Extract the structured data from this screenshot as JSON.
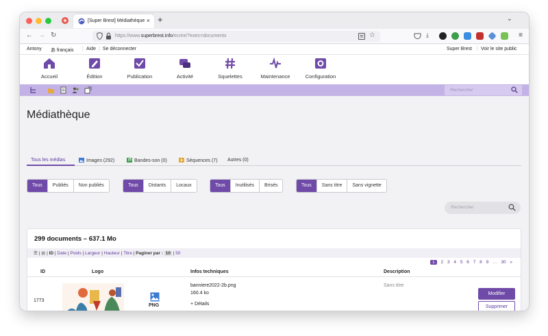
{
  "browser": {
    "tab_title": "[Super Brest] Médiathèque",
    "new_tab_symbol": "+",
    "close_symbol": "×",
    "url_prefix": "https://www.",
    "url_domain": "superbrest.info",
    "url_path": "/ecrire/?exec=documents"
  },
  "topbar": {
    "user": "Antony",
    "language": "français",
    "help": "Aide",
    "logout": "Se déconnecter",
    "site_name": "Super Brest",
    "view_site": "Voir le site public"
  },
  "main_menu": [
    {
      "label": "Accueil",
      "icon": "home-icon"
    },
    {
      "label": "Édition",
      "icon": "edit-pencil-icon"
    },
    {
      "label": "Publication",
      "icon": "checkbox-icon"
    },
    {
      "label": "Activité",
      "icon": "chat-bubbles-icon"
    },
    {
      "label": "Squelettes",
      "icon": "hash-icon"
    },
    {
      "label": "Maintenance",
      "icon": "pulse-icon"
    },
    {
      "label": "Configuration",
      "icon": "gear-icon"
    }
  ],
  "sub_search_placeholder": "Rechercher",
  "page_title": "Médiathèque",
  "type_tabs": [
    {
      "label": "Tous les médias",
      "active": true
    },
    {
      "label": "Images (292)",
      "icon": "image-icon"
    },
    {
      "label": "Bandes-son (0)",
      "icon": "audio-icon"
    },
    {
      "label": "Séquences (7)",
      "icon": "video-icon"
    },
    {
      "label": "Autres (0)"
    }
  ],
  "filters": {
    "status": [
      "Tous",
      "Publiés",
      "Non publiés"
    ],
    "origin": [
      "Tous",
      "Distants",
      "Locaux"
    ],
    "usage": [
      "Tous",
      "Inutilisés",
      "Brisés"
    ],
    "meta": [
      "Tous",
      "Sans titre",
      "Sans vignette"
    ]
  },
  "search_placeholder": "Rechercher",
  "list": {
    "title": "299 documents – 637.1 Mo",
    "sort_label_id": "ID",
    "sort_links": [
      "Date",
      "Poids",
      "Largeur",
      "Hauteur",
      "Titre"
    ],
    "pager_label": "Paginer par :",
    "pager_current": "10",
    "pager_other": "50",
    "pages": [
      "1",
      "2",
      "3",
      "4",
      "5",
      "6",
      "7",
      "8",
      "9",
      "…",
      "30",
      "»"
    ],
    "columns": [
      "ID",
      "Logo",
      "Infos techniques",
      "Description"
    ],
    "rows": [
      {
        "id": "1773",
        "format": "PNG",
        "filename": "banniere2022-2b.png",
        "size": "160.4 ko",
        "details": "+ Détails",
        "description": "Sans titre",
        "modify": "Modifier",
        "delete": "Supprimer"
      }
    ]
  },
  "colors": {
    "accent": "#6f4aa8",
    "subbar": "#c3b2e6",
    "link": "#5e3a9c"
  }
}
